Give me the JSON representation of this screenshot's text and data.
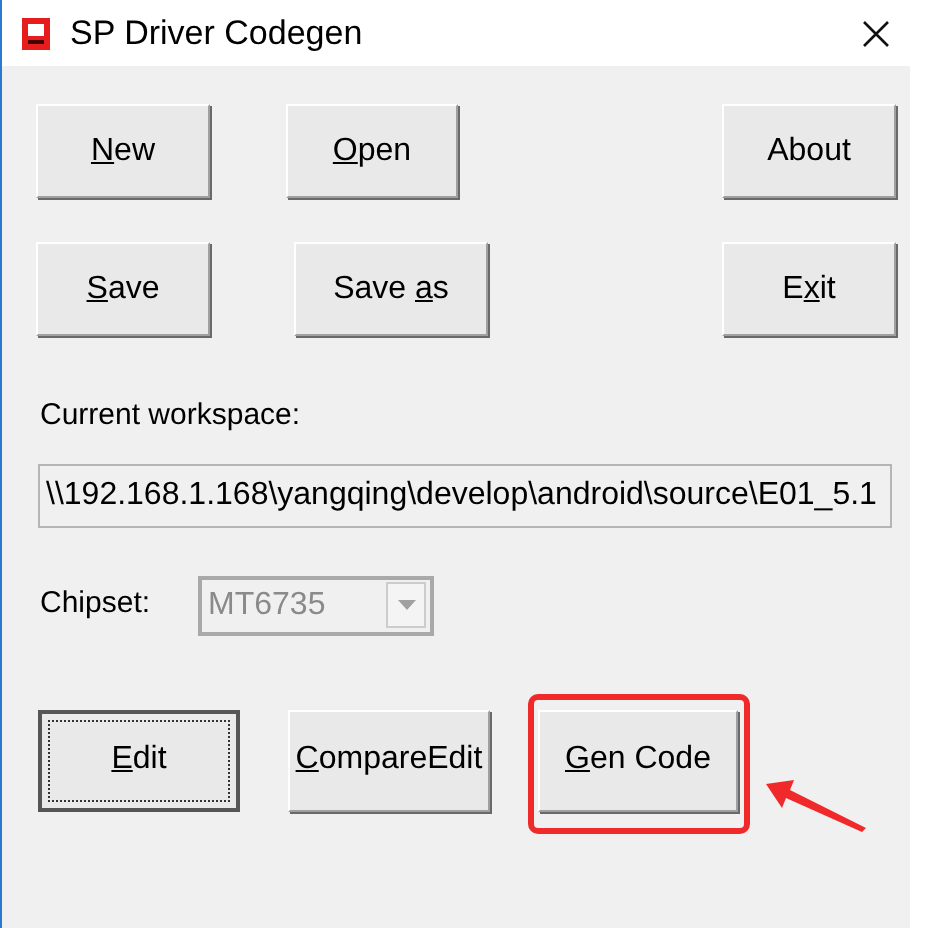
{
  "window": {
    "title": "SP Driver Codegen"
  },
  "button_grid": [
    {
      "label": {
        "key": "N",
        "after": "ew"
      }
    },
    {
      "label": {
        "key": "O",
        "after": "pen"
      }
    },
    {
      "label": {
        "before": "About"
      }
    },
    {
      "label": {
        "key": "S",
        "after": "ave"
      }
    },
    {
      "label": {
        "before": "Save ",
        "key": "a",
        "after": "s"
      }
    },
    {
      "label": {
        "before": "E",
        "key": "x",
        "after": "it"
      }
    }
  ],
  "workspace": {
    "label": "Current workspace:",
    "value": "\\\\192.168.1.168\\yangqing\\develop\\android\\source\\E01_5.1"
  },
  "chipset": {
    "label": "Chipset:",
    "value": "MT6735",
    "disabled": true
  },
  "action_buttons": [
    {
      "label": {
        "key": "E",
        "after": "dit"
      },
      "focused": true,
      "highlighted": false
    },
    {
      "label": {
        "key": "C",
        "after": "ompareEdit"
      },
      "focused": false,
      "highlighted": false
    },
    {
      "label": {
        "key": "G",
        "after": "en Code"
      },
      "focused": false,
      "highlighted": true
    }
  ]
}
